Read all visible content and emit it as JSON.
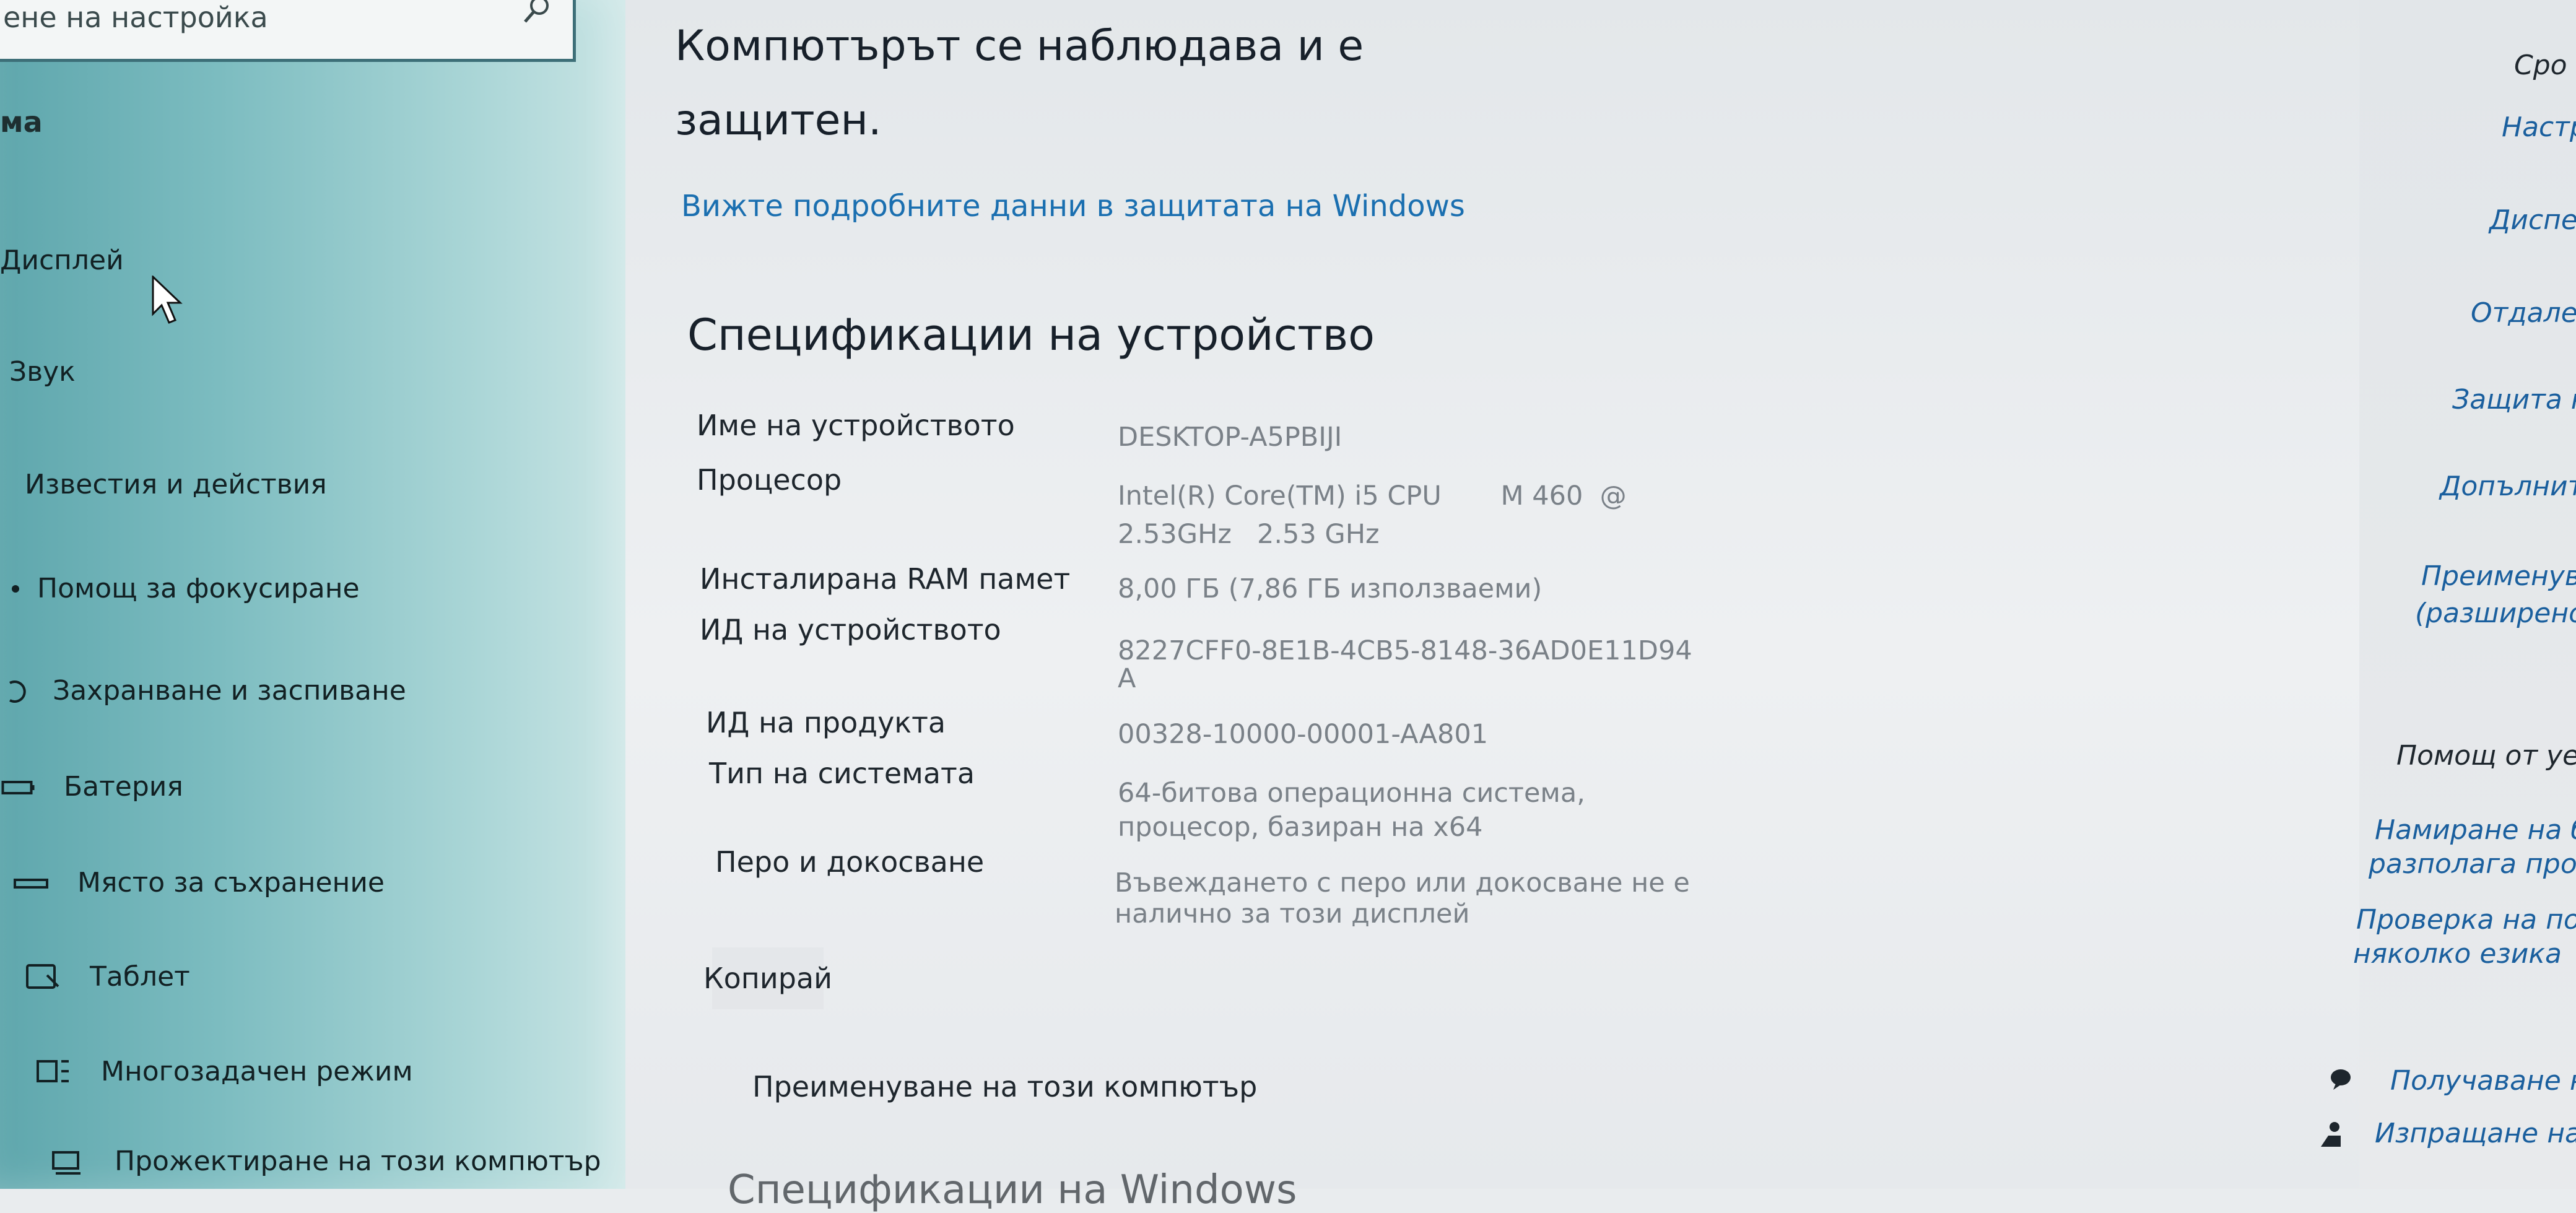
{
  "search": {
    "placeholder": "ене на настройка"
  },
  "sidebar": {
    "heading": "ма",
    "items": [
      {
        "label": "Дисплей",
        "icon": "display-icon"
      },
      {
        "label": "Звук",
        "icon": "sound-icon"
      },
      {
        "label": "Известия и действия",
        "icon": "notifications-icon"
      },
      {
        "label": "Помощ за фокусиране",
        "icon": "moon-icon"
      },
      {
        "label": "Захранване и заспиване",
        "icon": "power-icon"
      },
      {
        "label": "Батерия",
        "icon": "battery-icon"
      },
      {
        "label": "Място за съхранение",
        "icon": "storage-icon"
      },
      {
        "label": "Таблет",
        "icon": "tablet-icon"
      },
      {
        "label": "Многозадачен режим",
        "icon": "multitasking-icon"
      },
      {
        "label": "Прожектиране на този компютър",
        "icon": "projecting-icon"
      }
    ]
  },
  "main": {
    "status_line1": "Компютърът се наблюдава и е",
    "status_line2": "защитен.",
    "security_link": "Вижте подробните данни в защитата на Windows",
    "specs_title": "Спецификации на устройство",
    "specs": [
      {
        "label": "Име на устройството",
        "value": "DESKTOP-A5PBIJI"
      },
      {
        "label": "Процесор",
        "value": "Intel(R) Core(TM) i5 CPU       M 460  @",
        "value2": "2.53GHz   2.53 GHz"
      },
      {
        "label": "Инсталирана RAM памет",
        "value": "8,00 ГБ (7,86 ГБ използваеми)"
      },
      {
        "label": "ИД на устройството",
        "value": "8227CFF0-8E1B-4CB5-8148-36AD0E11D94",
        "value2": "A"
      },
      {
        "label": "ИД на продукта",
        "value": "00328-10000-00001-AA801"
      },
      {
        "label": "Тип на системата",
        "value": "64-битова операционна система,",
        "value2": "процесор, базиран на x64"
      },
      {
        "label": "Перо и докосване",
        "value": "Въвеждането с перо или докосване не е",
        "value2": "налично за този дисплей"
      }
    ],
    "copy_button": "Копирай",
    "rename_link": "Преименуване на този компютър",
    "next_heading": "Спецификации на Windows"
  },
  "related": {
    "items": [
      "Сро",
      "Настр",
      "Диспе",
      "Отдале",
      "Защита н",
      "Допълнит",
      "Преименув",
      "(разширено",
      "Помощ от уе",
      "Намиране на б",
      "разполага проц",
      "Проверка на под",
      "няколко езика",
      "Получаване н",
      "Изпращане на"
    ]
  }
}
